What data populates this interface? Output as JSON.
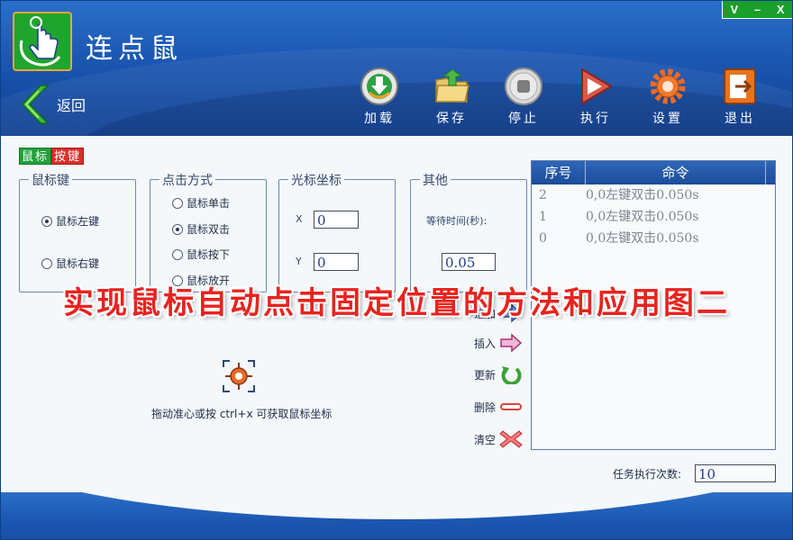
{
  "app": {
    "title": "连点鼠",
    "window_controls": [
      "V",
      "–",
      "X"
    ]
  },
  "nav": {
    "back_label": "返回"
  },
  "toolbar": [
    {
      "label": "加载",
      "icon": "load-icon"
    },
    {
      "label": "保存",
      "icon": "save-icon"
    },
    {
      "label": "停止",
      "icon": "stop-icon"
    },
    {
      "label": "执行",
      "icon": "play-icon"
    },
    {
      "label": "设置",
      "icon": "gear-icon"
    },
    {
      "label": "退出",
      "icon": "exit-icon"
    }
  ],
  "tabs": {
    "mouse": "鼠标",
    "key": "按键"
  },
  "mouse_key": {
    "title": "鼠标键",
    "left": "鼠标左键",
    "right": "鼠标右键",
    "selected": "left"
  },
  "click_mode": {
    "title": "点击方式",
    "options": [
      "鼠标单击",
      "鼠标双击",
      "鼠标按下",
      "鼠标放开"
    ],
    "selected": "鼠标双击"
  },
  "cursor": {
    "title": "光标坐标",
    "x_label": "X",
    "x_value": "0",
    "y_label": "Y",
    "y_value": "0"
  },
  "other": {
    "title": "其他",
    "wait_label": "等待时间(秒):",
    "wait_value": "0.05"
  },
  "picker": {
    "hint": "拖动准心或按 ctrl+x 可获取鼠标坐标"
  },
  "actions": [
    {
      "label": "追加",
      "icon": "arrow-right-icon"
    },
    {
      "label": "插入",
      "icon": "insert-arrow-icon"
    },
    {
      "label": "更新",
      "icon": "refresh-icon"
    },
    {
      "label": "删除",
      "icon": "minus-icon"
    },
    {
      "label": "清空",
      "icon": "clear-x-icon"
    }
  ],
  "commands": {
    "headers": [
      "序号",
      "命令"
    ],
    "rows": [
      {
        "index": "2",
        "command": "0,0左键双击0.050s"
      },
      {
        "index": "1",
        "command": "0,0左键双击0.050s"
      },
      {
        "index": "0",
        "command": "0,0左键双击0.050s"
      }
    ]
  },
  "task": {
    "label": "任务执行次数:",
    "value": "10"
  },
  "overlay_caption": "实现鼠标自动点击固定位置的方法和应用图二",
  "colors": {
    "header_blue": "#1b56b1",
    "accent_green": "#1fa52e",
    "overlay_red": "#e8231f"
  }
}
